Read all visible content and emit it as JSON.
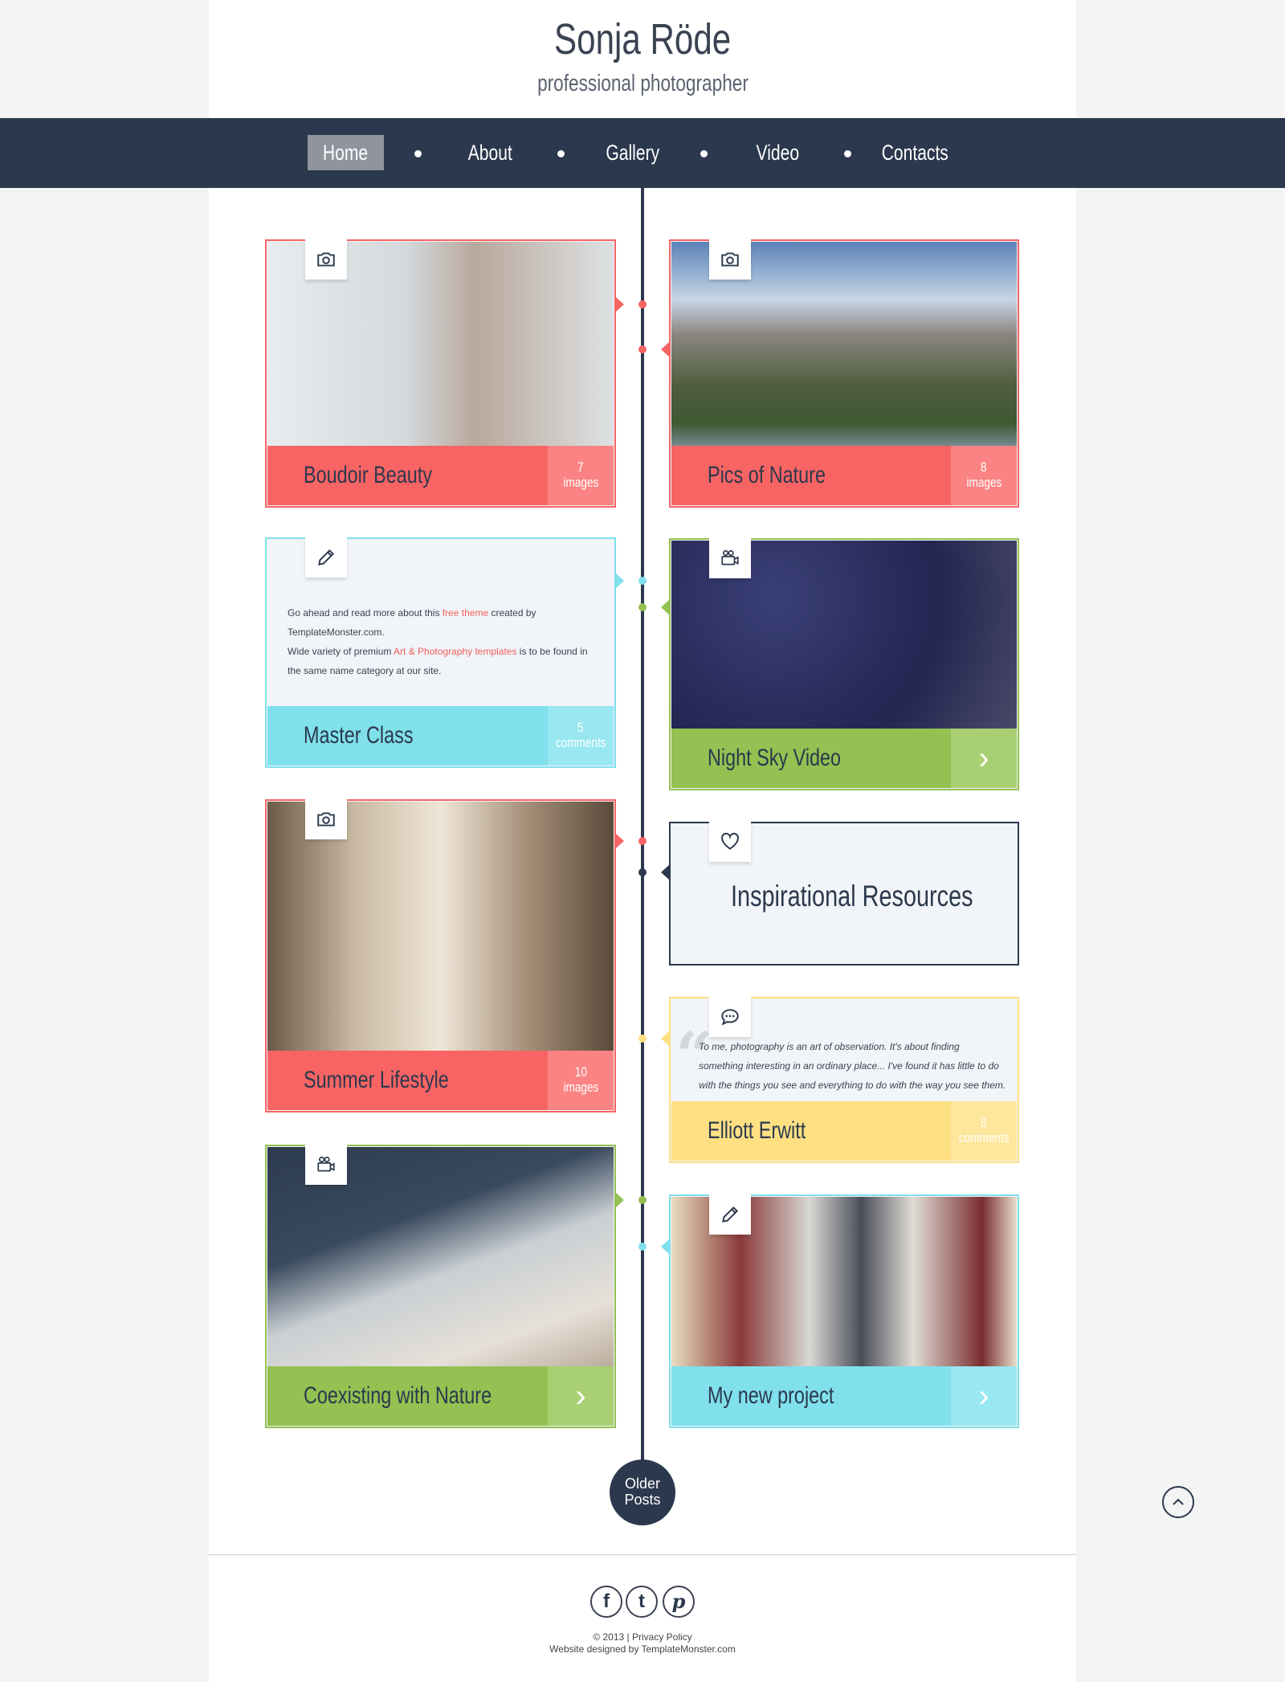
{
  "header": {
    "title": "Sonja Röde",
    "subtitle": "professional photographer"
  },
  "nav": {
    "items": [
      {
        "label": "Home",
        "active": true
      },
      {
        "label": "About"
      },
      {
        "label": "Gallery"
      },
      {
        "label": "Video"
      },
      {
        "label": "Contacts"
      }
    ]
  },
  "colors": {
    "navy": "#2b384d",
    "red": "#f86464",
    "blue": "#80e0ec",
    "green": "#93c152",
    "yellow": "#fee083"
  },
  "posts": [
    {
      "title": "Boudoir Beauty",
      "count": "7",
      "unit": "images",
      "icon": "camera-icon",
      "color": "red"
    },
    {
      "title": "Pics of Nature",
      "count": "8",
      "unit": "images",
      "icon": "camera-icon",
      "color": "red"
    },
    {
      "title": "Master Class",
      "count": "5",
      "unit": "comments",
      "icon": "pencil-icon",
      "color": "blue",
      "text": {
        "p1a": "Go ahead and read more about this ",
        "link1": "free theme",
        "p1b": " created by TemplateMonster.com.",
        "p2a": "Wide variety of premium ",
        "link2": "Art & Photography templates",
        "p2b": " is to be found in the same name category at our site."
      }
    },
    {
      "title": "Night Sky Video",
      "icon": "video-camera-icon",
      "color": "green",
      "action": "chevron-right-icon"
    },
    {
      "title": "Summer Lifestyle",
      "count": "10",
      "unit": "images",
      "icon": "camera-icon",
      "color": "red"
    },
    {
      "title": "Inspirational Resources",
      "icon": "heart-icon",
      "color": "navy"
    },
    {
      "title": "Elliott Erwitt",
      "count": "8",
      "unit": "comments",
      "icon": "chat-icon",
      "color": "yellow",
      "quote": "To me, photography is an art of observation. It's about finding something interesting in an ordinary place... I've found it has little to do with the things you see and everything to do with the way you see them."
    },
    {
      "title": "Coexisting with Nature",
      "icon": "video-camera-icon",
      "color": "green",
      "action": "chevron-right-icon"
    },
    {
      "title": "My new project",
      "icon": "pencil-icon",
      "color": "blue",
      "action": "chevron-right-icon"
    }
  ],
  "older_posts": "Older Posts",
  "footer": {
    "social": [
      "facebook-icon",
      "tumblr-icon",
      "pinterest-icon"
    ],
    "copyright": "© 2013 | ",
    "privacy": "Privacy Policy",
    "designed": "Website designed by TemplateMonster.com"
  }
}
